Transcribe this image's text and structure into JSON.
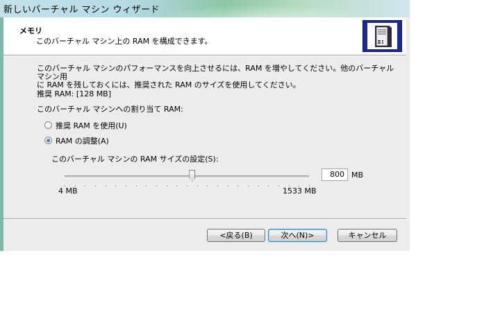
{
  "window": {
    "title": "新しいバーチャル マシン ウィザード"
  },
  "header": {
    "title": "メモリ",
    "subtitle": "このバーチャル マシン上の RAM を構成できます。",
    "icon": "computer-tower-icon"
  },
  "body": {
    "description_line1": "このバーチャル マシンのパフォーマンスを向上させるには、RAM を増やしてください。他のバーチャル マシン用",
    "description_line2": "に RAM を残しておくには、推奨された RAM のサイズを使用してください。",
    "recommended_ram": "推奨 RAM: [128 MB]",
    "assign_label": "このバーチャル マシンへの割り当て RAM:",
    "options": [
      {
        "label": "推奨 RAM を使用(U)",
        "selected": false
      },
      {
        "label": "RAM の調整(A)",
        "selected": true
      }
    ],
    "size_setting_label": "このバーチャル マシンの RAM サイズの設定(S):",
    "slider": {
      "min_label": "4 MB",
      "max_label": "1533 MB",
      "min_value": 4,
      "max_value": 1533,
      "value": 800
    },
    "ram_value": "800",
    "unit_label": "MB"
  },
  "buttons": {
    "back": "<戻る(B)",
    "next": "次へ(N)>",
    "cancel": "キャンセル"
  }
}
